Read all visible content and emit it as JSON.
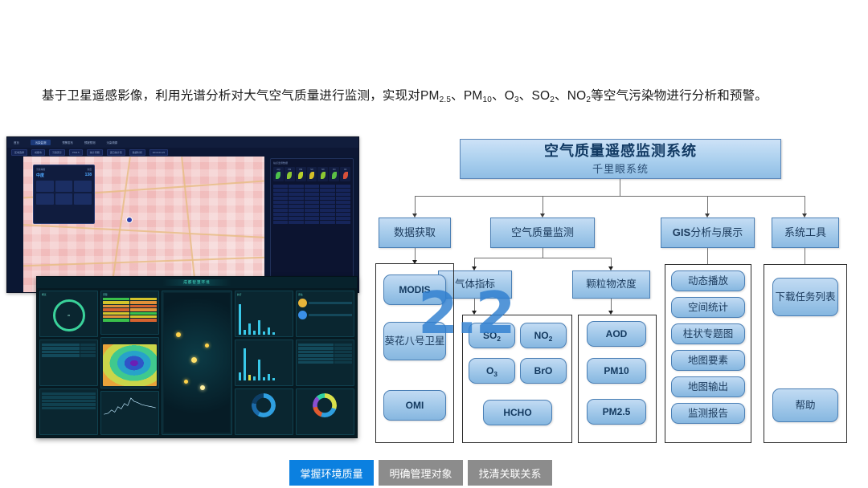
{
  "intro": {
    "prefix": "基于卫星遥感影像，利用光谱分析对大气空气质量进行监测，实现对PM",
    "s1": "2.5",
    "mid1": "、PM",
    "s2": "10",
    "mid2": "、O",
    "s3": "3",
    "mid3": "、SO",
    "s4": "2",
    "mid4": "、NO",
    "s5": "2",
    "suffix": "等空气污染物进行分析和预警。"
  },
  "watermark": "2.2",
  "diagram": {
    "title": {
      "main": "空气质量遥感监测系统",
      "sub": "千里眼系统"
    },
    "level2": [
      {
        "label": "数据获取"
      },
      {
        "label": "空气质量监测"
      },
      {
        "label_bold": "GIS",
        "label_rest": "分析与展示"
      },
      {
        "label": "系统工具"
      }
    ],
    "level3": [
      {
        "label": "气体指标"
      },
      {
        "label": "颗粒物浓度"
      }
    ],
    "groups": {
      "data_source": {
        "items": [
          {
            "text": "MODIS",
            "type": "latin"
          },
          {
            "text": "葵花八号卫星",
            "type": "cn"
          },
          {
            "text": "OMI",
            "type": "latin"
          }
        ]
      },
      "gas": {
        "items": [
          {
            "text": "SO",
            "sub": "2"
          },
          {
            "text": "NO",
            "sub": "2"
          },
          {
            "text": "O",
            "sub": "3"
          },
          {
            "text": "BrO",
            "sub": ""
          },
          {
            "text": "HCHO",
            "sub": ""
          }
        ]
      },
      "particle": {
        "items": [
          {
            "text": "AOD"
          },
          {
            "text": "PM10"
          },
          {
            "text": "PM2.5"
          }
        ]
      },
      "gis": {
        "items": [
          {
            "text": "动态播放"
          },
          {
            "text": "空间统计"
          },
          {
            "text": "柱状专题图"
          },
          {
            "text": "地图要素"
          },
          {
            "text": "地图输出"
          },
          {
            "text": "监测报告"
          }
        ]
      },
      "tools": {
        "items": [
          {
            "text": "下载任务列表"
          },
          {
            "text": "帮助"
          }
        ]
      }
    }
  },
  "screenshots": {
    "map_app": {
      "tabs": [
        "首页",
        "污染监测",
        "预警发布",
        "预报预测",
        "污染溯源"
      ],
      "active_tab": "污染监测",
      "filters": [
        "区域选择",
        "成都市",
        "污染因子",
        "PM2.5",
        "统计周期",
        "逐日统计值",
        "数据时间",
        "2019-03-25"
      ],
      "legend": {
        "label_left": "污染等级",
        "label_right": "浓度",
        "value_left": "中度",
        "value_right": "138"
      },
      "panel_title": "站点监测数据"
    },
    "dashboard": {
      "title": "成都智慧环境",
      "col_headers": [
        "概览",
        "预警",
        "治理",
        "执行",
        "评估"
      ]
    }
  },
  "tabbar": {
    "tabs": [
      {
        "label": "掌握环境质量",
        "active": true
      },
      {
        "label": "明确管理对象",
        "active": false
      },
      {
        "label": "找清关联关系",
        "active": false
      }
    ]
  },
  "colors": {
    "accent_blue": "#0b80e0",
    "node_fill": "#a9cdec",
    "node_border": "#4a7fb5",
    "tab_inactive": "#8c8c8c",
    "watermark": "#2f7fd0"
  }
}
